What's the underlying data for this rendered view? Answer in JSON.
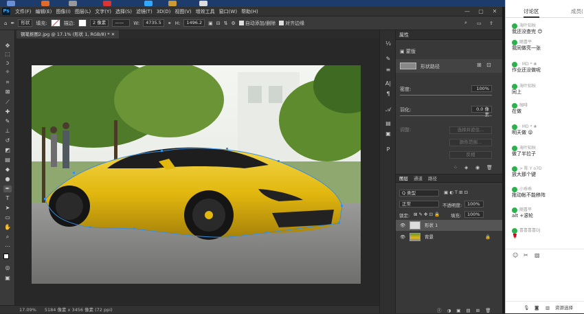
{
  "menubar": {
    "app_icon": "Ps",
    "menus": [
      "文件(F)",
      "编辑(E)",
      "图像(I)",
      "图层(L)",
      "文字(Y)",
      "选择(S)",
      "滤镜(T)",
      "3D(D)",
      "视图(V)",
      "增效工具",
      "窗口(W)",
      "帮助(H)"
    ],
    "min": "—",
    "max": "▢",
    "close": "✕"
  },
  "options": {
    "shape_mode": "形状",
    "fill_label": "填充:",
    "stroke_label": "描边:",
    "stroke_width": "2 像素",
    "w_label": "W:",
    "w_value": "4735.5",
    "h_label": "H:",
    "h_value": "1496.2",
    "auto_add_delete": "自动添加/删除",
    "align_edges": "对齐边缘"
  },
  "document": {
    "tab_title": "钢笔抠图2.jpg @ 17.1% (形状 1, RGB/8) *"
  },
  "status": {
    "zoom": "17.09%",
    "size": "5184 像素 x 3456 像素 (72 ppi)"
  },
  "properties": {
    "title": "属性",
    "mask_label": "蒙版",
    "shape_path": "形状路径",
    "density_label": "密度:",
    "density_value": "100%",
    "feather_label": "羽化:",
    "feather_value": "0.0 像素",
    "refine_label": "调整:",
    "select_and_mask": "选择并遮住...",
    "color_range": "颜色范围...",
    "invert": "反相"
  },
  "layers": {
    "tabs": [
      "图层",
      "通道",
      "路径"
    ],
    "filter": "Q 类型",
    "blend_mode": "正常",
    "opacity_label": "不透明度:",
    "opacity_value": "100%",
    "lock_label": "锁定:",
    "fill_label": "填充:",
    "fill_value": "100%",
    "items": [
      {
        "name": "形状 1"
      },
      {
        "name": "背景"
      }
    ]
  },
  "chat": {
    "tabs": [
      "讨论区",
      "成员("
    ],
    "messages": [
      {
        "who": "海叶知秋",
        "text": "我还没查完"
      },
      {
        "who": "随喜平",
        "text": "我同做亮一张"
      },
      {
        "who": "· MD * ",
        "text": "作业还没做呢"
      },
      {
        "who": "海叶知秋",
        "text": "同上"
      },
      {
        "who": "咖啡",
        "text": "在做"
      },
      {
        "who": "· MD * ",
        "text": "明天做"
      },
      {
        "who": "海叶知秋",
        "text": "做了半拉子"
      },
      {
        "who": "> 陈 Y o7D",
        "text": "放大那个键"
      },
      {
        "who": "小乖乖",
        "text": "拖动帐不能移阵"
      },
      {
        "who": "随喜平",
        "text": "alt +滚轮"
      },
      {
        "who": "喜喜喜喜DJ",
        "text": ""
      }
    ],
    "bottom_text": "资源选择"
  },
  "colors": {
    "photoshop_blue": "#31a8ff",
    "wechat_green": "#2bb24c",
    "car_yellow": "#e2b80f"
  }
}
